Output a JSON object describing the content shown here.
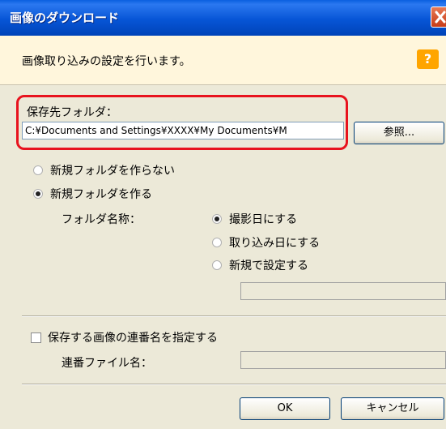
{
  "window": {
    "title": "画像のダウンロード",
    "close_icon": "close-x-icon"
  },
  "header": {
    "text": "画像取り込みの設定を行います。",
    "help_label": "?"
  },
  "destination": {
    "label": "保存先フォルダ：",
    "path": "C:¥Documents and Settings¥XXXX¥My Documents¥M",
    "browse_label": "参照..."
  },
  "folder_options": {
    "no_new_folder": "新規フォルダを作らない",
    "new_folder": "新規フォルダを作る",
    "selected": "new_folder"
  },
  "folder_name": {
    "label": "フォルダ名称：",
    "options": [
      "撮影日にする",
      "取り込み日にする",
      "新規で設定する"
    ],
    "selected_index": 0,
    "custom_value": ""
  },
  "sequence": {
    "checkbox_label": "保存する画像の連番名を指定する",
    "checked": false,
    "file_label": "連番ファイル名：",
    "file_value": ""
  },
  "footer": {
    "ok_label": "OK",
    "cancel_label": "キャンセル"
  },
  "colors": {
    "titlebar": "#0755d6",
    "header_band": "#fff6dc",
    "highlight": "#e8131e",
    "help_badge": "#ffa500"
  }
}
